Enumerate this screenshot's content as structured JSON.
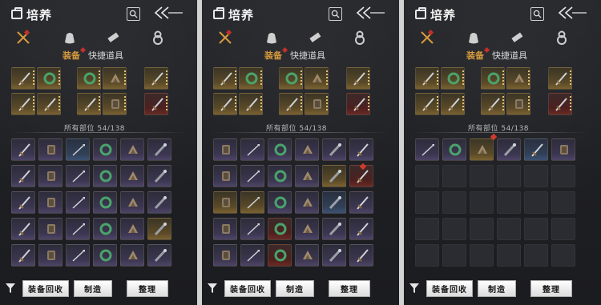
{
  "screens": [
    {
      "title": "培养",
      "tab_equip": "装备",
      "tab_quick": "快捷道具",
      "count_label": "所有部位 54/138",
      "buttons": {
        "recycle": "装备回收",
        "craft": "制造",
        "sort": "整理"
      }
    },
    {
      "title": "培养",
      "tab_equip": "装备",
      "tab_quick": "快捷道具",
      "count_label": "所有部位 54/138",
      "buttons": {
        "recycle": "装备回收",
        "craft": "制造",
        "sort": "整理"
      }
    },
    {
      "title": "培养",
      "tab_equip": "装备",
      "tab_quick": "快捷道具",
      "count_label": "所有部位 54/138",
      "buttons": {
        "recycle": "装备回收",
        "craft": "制造",
        "sort": "整理"
      }
    }
  ],
  "icons": [
    "bag-icon",
    "search-icon",
    "back-arrow-icon",
    "crossed-swords-icon",
    "pouch-icon",
    "scroll-icon",
    "gourd-icon",
    "filter-icon"
  ],
  "colors": {
    "accent": "#d59a3c",
    "slot_gold": "#7a6231",
    "slot_purple": "#4d4566",
    "slot_blue": "#3d5272",
    "slot_red": "#6a2a24"
  }
}
